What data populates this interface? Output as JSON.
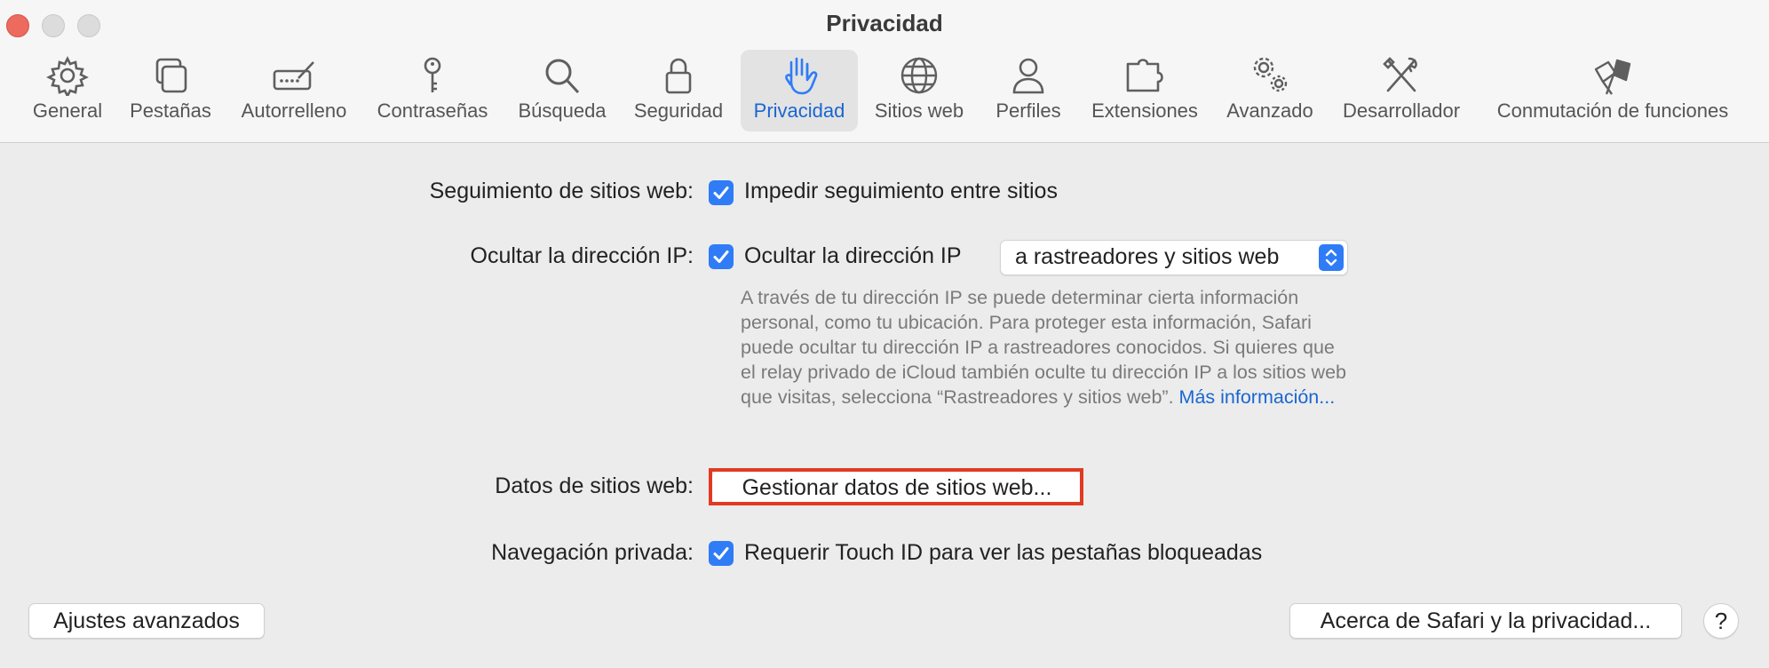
{
  "window": {
    "title": "Privacidad"
  },
  "toolbar": {
    "items": [
      {
        "label": "General",
        "icon": "gear-icon"
      },
      {
        "label": "Pestañas",
        "icon": "tabs-icon"
      },
      {
        "label": "Autorrelleno",
        "icon": "autofill-icon"
      },
      {
        "label": "Contraseñas",
        "icon": "key-icon"
      },
      {
        "label": "Búsqueda",
        "icon": "magnifier-icon"
      },
      {
        "label": "Seguridad",
        "icon": "lock-icon"
      },
      {
        "label": "Privacidad",
        "icon": "hand-icon",
        "active": true
      },
      {
        "label": "Sitios web",
        "icon": "globe-icon"
      },
      {
        "label": "Perfiles",
        "icon": "person-icon"
      },
      {
        "label": "Extensiones",
        "icon": "puzzle-icon"
      },
      {
        "label": "Avanzado",
        "icon": "gears-icon"
      },
      {
        "label": "Desarrollador",
        "icon": "tools-icon"
      },
      {
        "label": "Conmutación de funciones",
        "icon": "flags-icon"
      }
    ]
  },
  "settings": {
    "tracking": {
      "label": "Seguimiento de sitios web:",
      "checkbox_label": "Impedir seguimiento entre sitios",
      "checked": true
    },
    "hide_ip": {
      "label": "Ocultar la dirección IP:",
      "checkbox_label": "Ocultar la dirección IP",
      "checked": true,
      "select_value": "a rastreadores y sitios web",
      "description": "A través de tu dirección IP se puede determinar cierta información personal, como tu ubicación. Para proteger esta información, Safari puede ocultar tu dirección IP a rastreadores conocidos. Si quieres que el relay privado de iCloud también oculte tu dirección IP a los sitios web que visitas, selecciona “Rastreadores y sitios web”.",
      "more_info_link": "Más información..."
    },
    "website_data": {
      "label": "Datos de sitios web:",
      "button_label": "Gestionar datos de sitios web..."
    },
    "private_browsing": {
      "label": "Navegación privada:",
      "checkbox_label": "Requerir Touch ID para ver las pestañas bloqueadas",
      "checked": true
    }
  },
  "footer": {
    "advanced_button": "Ajustes avanzados",
    "about_button": "Acerca de Safari y la privacidad...",
    "help_button": "?"
  },
  "colors": {
    "accent": "#2f7cf6",
    "active_label": "#1a66d2",
    "highlight_border": "#e23a22"
  }
}
